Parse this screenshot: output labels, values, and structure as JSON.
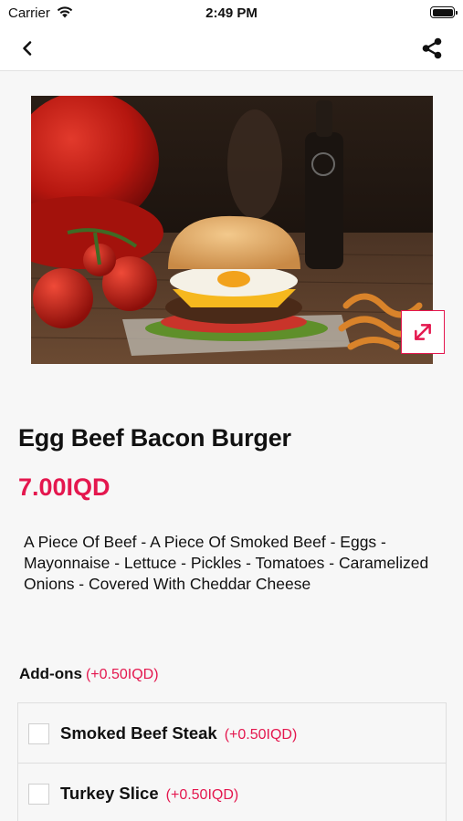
{
  "status_bar": {
    "carrier": "Carrier",
    "time": "2:49 PM"
  },
  "nav": {
    "back_icon": "chevron-left-icon",
    "share_icon": "share-icon"
  },
  "product": {
    "image_alt": "Burger photo",
    "name": "Egg Beef Bacon Burger",
    "price": "7.00IQD",
    "description": "A Piece Of Beef - A Piece Of Smoked Beef - Eggs - Mayonnaise - Lettuce - Pickles - Tomatoes - Caramelized Onions - Covered With Cheddar Cheese"
  },
  "addons": {
    "title": "Add-ons",
    "note": "(+0.50IQD)",
    "items": [
      {
        "name": "Smoked Beef Steak",
        "price": "(+0.50IQD)",
        "checked": false
      },
      {
        "name": "Turkey Slice",
        "price": "(+0.50IQD)",
        "checked": false
      }
    ]
  },
  "colors": {
    "accent": "#e4174e",
    "background": "#f7f7f7"
  }
}
